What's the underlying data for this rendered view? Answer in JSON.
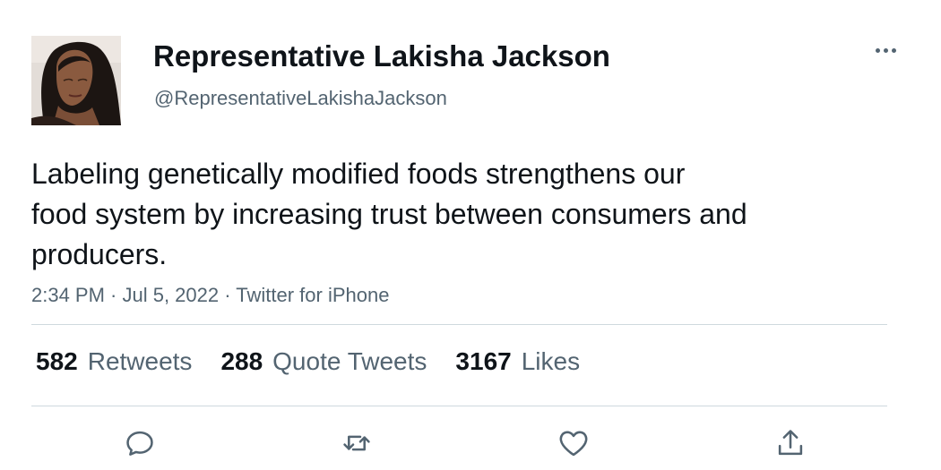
{
  "author": {
    "display_name": "Representative Lakisha Jackson",
    "handle": "@RepresentativeLakishaJackson"
  },
  "tweet": {
    "text_lines": [
      "Labeling genetically modified foods strengthens our",
      "food system by increasing trust between consumers and",
      "producers."
    ],
    "meta": "2:34 PM · Jul 5, 2022 · Twitter for iPhone"
  },
  "stats": {
    "retweets": {
      "count": "582",
      "label": "Retweets"
    },
    "quote_tweets": {
      "count": "288",
      "label": "Quote Tweets"
    },
    "likes": {
      "count": "3167",
      "label": "Likes"
    }
  },
  "icons": {
    "more": "more-horizontal-icon",
    "reply": "reply-icon",
    "retweet": "retweet-icon",
    "like": "heart-icon",
    "share": "share-icon"
  },
  "colors": {
    "text_primary": "#0f1419",
    "text_secondary": "#536471",
    "divider": "#cfd9de",
    "background": "#ffffff"
  }
}
